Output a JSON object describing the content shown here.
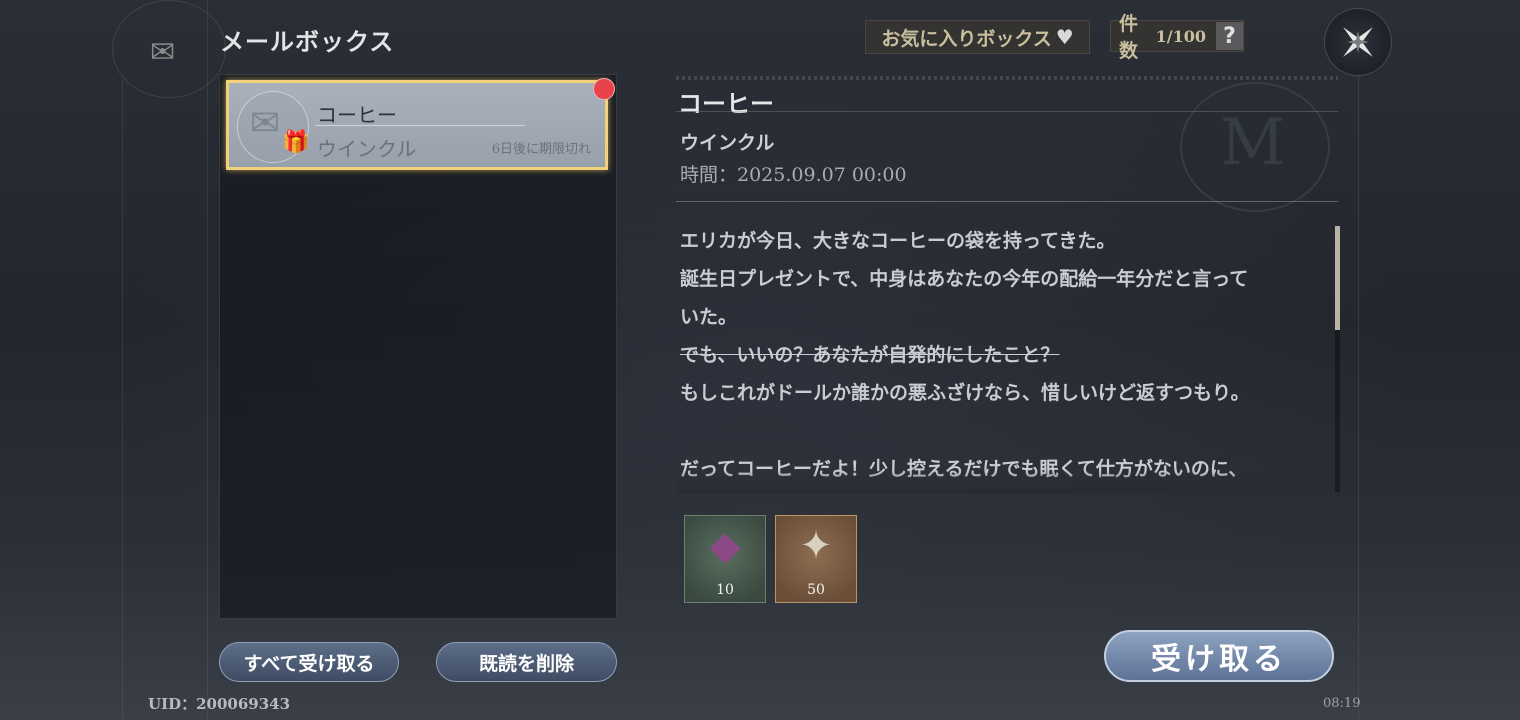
{
  "header": {
    "title": "メールボックス",
    "favorites_label": "お気に入りボックス",
    "count_label": "件数",
    "count_value": "1/100",
    "help_label": "?"
  },
  "mail_list": [
    {
      "subject": "コーヒー",
      "sender": "ウインクル",
      "expire": "6日後に期限切れ",
      "unread": true,
      "has_attachment": true
    }
  ],
  "detail": {
    "subject": "コーヒー",
    "sender": "ウインクル",
    "time": "時間：2025.09.07 00:00",
    "body_lines": [
      "エリカが今日、大きなコーヒーの袋を持ってきた。",
      "誕生日プレゼントで、中身はあなたの今年の配給一年分だと言って",
      "いた。",
      "でも、いいの？あなたが自発的にしたこと？",
      "もしこれがドールか誰かの悪ふざけなら、惜しいけど返すつもり。",
      "",
      "だってコーヒーだよ！少し控えるだけでも眠くて仕方がないのに、"
    ],
    "rewards": [
      {
        "icon": "dark-crystal-icon",
        "quantity": "10"
      },
      {
        "icon": "silver-star-emblem-icon",
        "quantity": "50"
      }
    ]
  },
  "footer": {
    "claim_all_label": "すべて受け取る",
    "delete_read_label": "既読を削除",
    "receive_label": "受け取る",
    "uid": "UID：200069343",
    "clock": "08:19"
  },
  "colors": {
    "selected_border": "#f1d27a",
    "unread_dot": "#e8424a",
    "gift_icon": "#7ad7e8"
  }
}
